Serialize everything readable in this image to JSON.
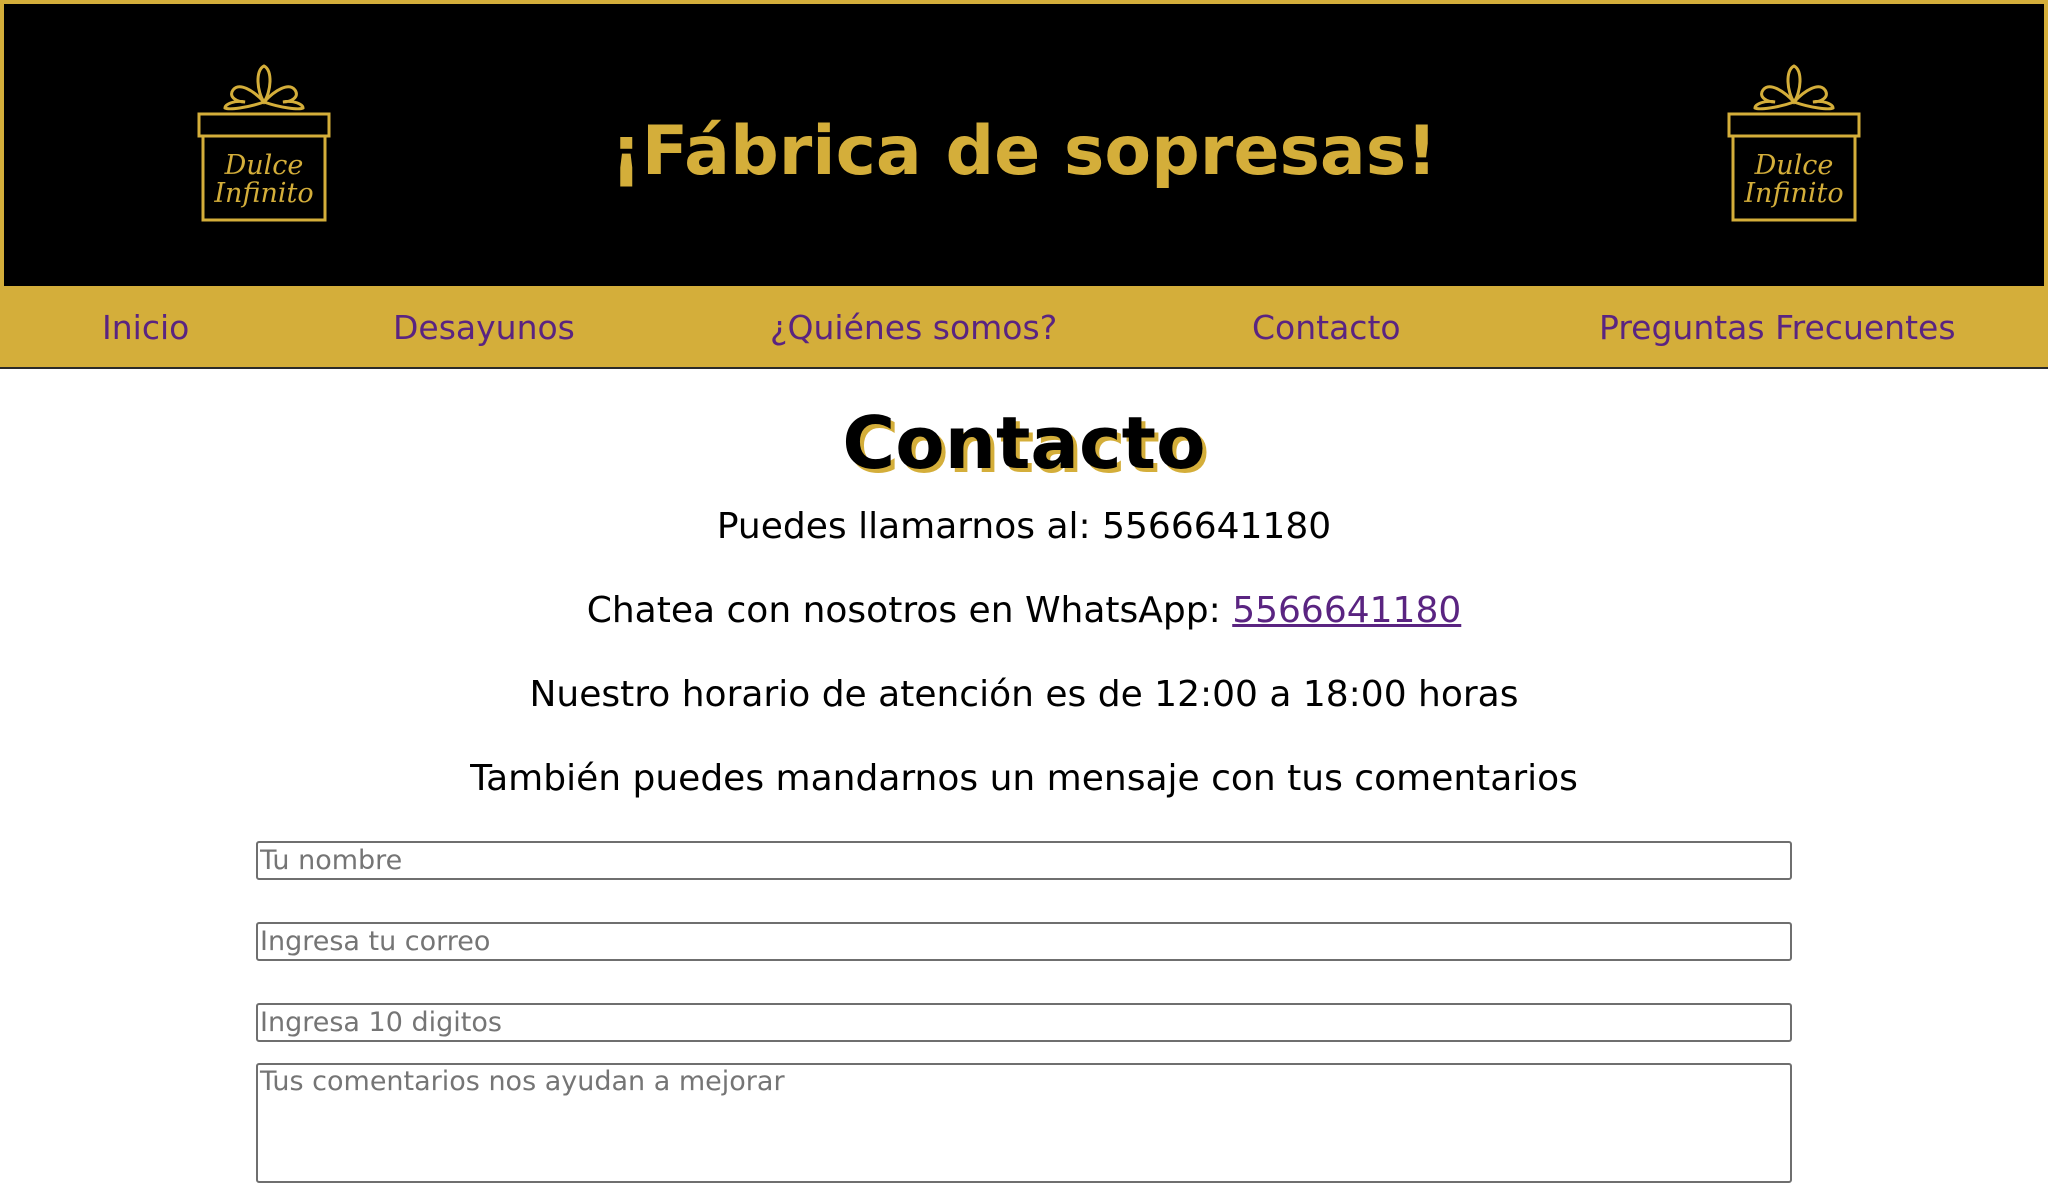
{
  "header": {
    "title": "¡Fábrica de sopresas!",
    "logo_line1": "Dulce",
    "logo_line2": "Infinito",
    "logo_icon": "gift-box-icon"
  },
  "nav": {
    "items": [
      {
        "label": "Inicio"
      },
      {
        "label": "Desayunos"
      },
      {
        "label": "¿Quiénes somos?"
      },
      {
        "label": "Contacto"
      },
      {
        "label": "Preguntas Frecuentes"
      }
    ]
  },
  "main": {
    "title": "Contacto",
    "phone_text": "Puedes llamarnos al: 5566641180",
    "whatsapp_text": "Chatea con nosotros en WhatsApp: ",
    "whatsapp_link": "5566641180",
    "hours_text": "Nuestro horario de atención es de 12:00 a 18:00 horas",
    "message_text": "También puedes mandarnos un mensaje con tus comentarios"
  },
  "form": {
    "name_placeholder": "Tu nombre",
    "email_placeholder": "Ingresa tu correo",
    "phone_placeholder": "Ingresa 10 digitos",
    "comments_placeholder": "Tus comentarios nos ayudan a mejorar"
  },
  "colors": {
    "gold": "#d4ae3a",
    "purple": "#5a2481",
    "black": "#000000"
  }
}
